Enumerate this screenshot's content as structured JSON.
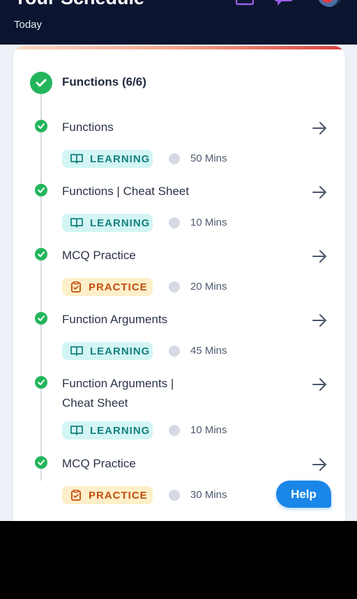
{
  "header": {
    "title": "Your Schedule",
    "subtitle": "Today"
  },
  "section": {
    "title": "Functions (6/6)"
  },
  "items": [
    {
      "title": "Functions",
      "tag": "LEARNING",
      "duration": "50 Mins"
    },
    {
      "title": "Functions | Cheat Sheet",
      "tag": "LEARNING",
      "duration": "10 Mins"
    },
    {
      "title": "MCQ Practice",
      "tag": "PRACTICE",
      "duration": "20 Mins"
    },
    {
      "title": "Function Arguments",
      "tag": "LEARNING",
      "duration": "45 Mins"
    },
    {
      "title": "Function Arguments | Cheat Sheet",
      "tag": "LEARNING",
      "duration": "10 Mins"
    },
    {
      "title": "MCQ Practice",
      "tag": "PRACTICE",
      "duration": "30 Mins"
    }
  ],
  "help": {
    "label": "Help"
  },
  "colors": {
    "header_bg": "#0b1530",
    "complete_green": "#22b55b",
    "learning_bg": "#d3f5f4",
    "learning_text": "#14807f",
    "practice_bg": "#fdefc9",
    "practice_text": "#c24d0c",
    "help_blue": "#1a86e8"
  },
  "icons": {
    "header": [
      "calendar-icon",
      "chat-icon"
    ],
    "learning": "book-icon",
    "practice": "clipboard-icon",
    "duration": "clock-icon",
    "open": "arrow-right-icon",
    "status": "check-icon"
  }
}
